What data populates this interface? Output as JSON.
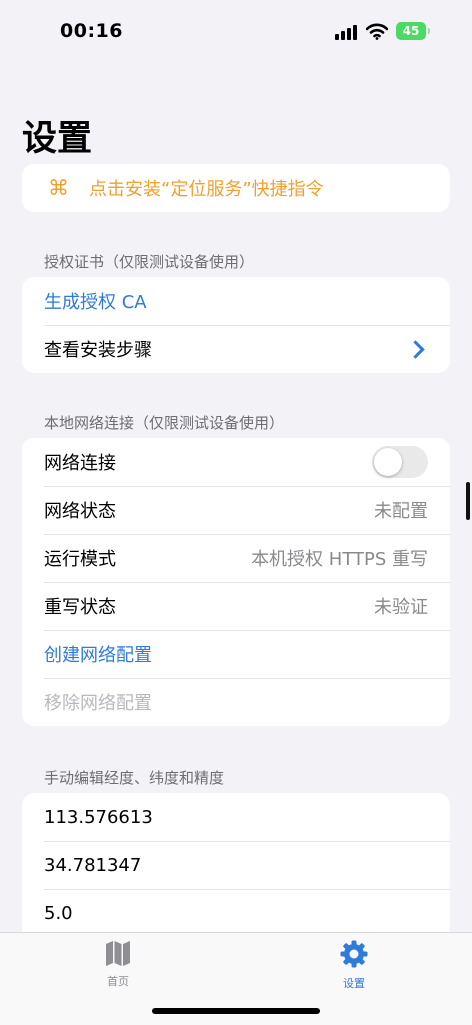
{
  "status_bar": {
    "time": "00:16",
    "battery": "45"
  },
  "page_title": "设置",
  "shortcut": {
    "icon": "command-icon",
    "label": "点击安装“定位服务”快捷指令"
  },
  "cert_section": {
    "header": "授权证书（仅限测试设备使用）",
    "generate_ca": "生成授权 CA",
    "view_steps": "查看安装步骤"
  },
  "network_section": {
    "header": "本地网络连接（仅限测试设备使用）",
    "connection_label": "网络连接",
    "connection_on": false,
    "status_label": "网络状态",
    "status_value": "未配置",
    "mode_label": "运行模式",
    "mode_value": "本机授权 HTTPS 重写",
    "rewrite_label": "重写状态",
    "rewrite_value": "未验证",
    "create_config": "创建网络配置",
    "remove_config": "移除网络配置"
  },
  "manual_section": {
    "header": "手动编辑经度、纬度和精度",
    "longitude": "113.576613",
    "latitude": "34.781347",
    "accuracy": "5.0"
  },
  "tabs": [
    {
      "label": "首页",
      "icon": "map-icon",
      "active": false
    },
    {
      "label": "设置",
      "icon": "gear-icon",
      "active": true
    }
  ],
  "colors": {
    "accent": "#2f7bd9",
    "orange": "#f0a030",
    "battery": "#4cd964"
  }
}
